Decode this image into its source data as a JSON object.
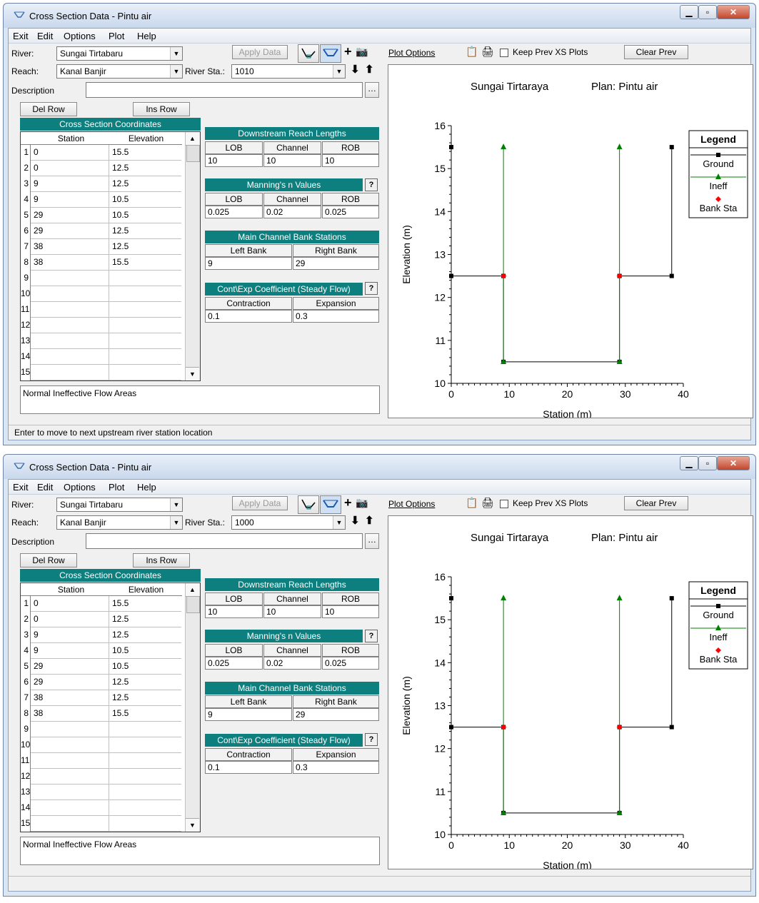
{
  "windows": [
    {
      "title": "Cross Section Data - Pintu air",
      "menu": [
        "Exit",
        "Edit",
        "Options",
        "Plot",
        "Help"
      ],
      "river_label": "River:",
      "river_value": "Sungai Tirtabaru",
      "reach_label": "Reach:",
      "reach_value": "Kanal Banjir",
      "river_sta_label": "River Sta.:",
      "river_sta_value": "1010",
      "apply_data": "Apply Data",
      "description_label": "Description",
      "del_row": "Del Row",
      "ins_row": "Ins Row",
      "xs_coords_title": "Cross Section Coordinates",
      "col_station": "Station",
      "col_elevation": "Elevation",
      "rows": [
        {
          "n": "1",
          "station": "0",
          "elevation": "15.5"
        },
        {
          "n": "2",
          "station": "0",
          "elevation": "12.5"
        },
        {
          "n": "3",
          "station": "9",
          "elevation": "12.5"
        },
        {
          "n": "4",
          "station": "9",
          "elevation": "10.5"
        },
        {
          "n": "5",
          "station": "29",
          "elevation": "10.5"
        },
        {
          "n": "6",
          "station": "29",
          "elevation": "12.5"
        },
        {
          "n": "7",
          "station": "38",
          "elevation": "12.5"
        },
        {
          "n": "8",
          "station": "38",
          "elevation": "15.5"
        },
        {
          "n": "9",
          "station": "",
          "elevation": ""
        },
        {
          "n": "10",
          "station": "",
          "elevation": ""
        },
        {
          "n": "11",
          "station": "",
          "elevation": ""
        },
        {
          "n": "12",
          "station": "",
          "elevation": ""
        },
        {
          "n": "13",
          "station": "",
          "elevation": ""
        },
        {
          "n": "14",
          "station": "",
          "elevation": ""
        },
        {
          "n": "15",
          "station": "",
          "elevation": ""
        }
      ],
      "downstream_title": "Downstream Reach Lengths",
      "lob": "LOB",
      "channel": "Channel",
      "rob": "ROB",
      "reach_lob": "10",
      "reach_channel": "10",
      "reach_rob": "10",
      "manning_title": "Manning's n Values",
      "n_lob": "0.025",
      "n_channel": "0.02",
      "n_rob": "0.025",
      "bank_title": "Main Channel Bank Stations",
      "left_bank_label": "Left Bank",
      "right_bank_label": "Right Bank",
      "left_bank": "9",
      "right_bank": "29",
      "coef_title": "Cont\\Exp Coefficient (Steady Flow)",
      "contraction_label": "Contraction",
      "expansion_label": "Expansion",
      "contraction": "0.1",
      "expansion": "0.3",
      "ineff_text": "Normal Ineffective Flow Areas",
      "status": "Enter to move to next upstream river station location",
      "plot_options": "Plot Options",
      "keep_prev": "Keep Prev XS Plots",
      "clear_prev": "Clear Prev",
      "plot_title_left": "Sungai Tirtaraya",
      "plot_title_right": "Plan: Pintu air"
    },
    {
      "title": "Cross Section Data - Pintu air",
      "menu": [
        "Exit",
        "Edit",
        "Options",
        "Plot",
        "Help"
      ],
      "river_label": "River:",
      "river_value": "Sungai Tirtabaru",
      "reach_label": "Reach:",
      "reach_value": "Kanal Banjir",
      "river_sta_label": "River Sta.:",
      "river_sta_value": "1000",
      "apply_data": "Apply Data",
      "description_label": "Description",
      "del_row": "Del Row",
      "ins_row": "Ins Row",
      "xs_coords_title": "Cross Section Coordinates",
      "col_station": "Station",
      "col_elevation": "Elevation",
      "rows": [
        {
          "n": "1",
          "station": "0",
          "elevation": "15.5"
        },
        {
          "n": "2",
          "station": "0",
          "elevation": "12.5"
        },
        {
          "n": "3",
          "station": "9",
          "elevation": "12.5"
        },
        {
          "n": "4",
          "station": "9",
          "elevation": "10.5"
        },
        {
          "n": "5",
          "station": "29",
          "elevation": "10.5"
        },
        {
          "n": "6",
          "station": "29",
          "elevation": "12.5"
        },
        {
          "n": "7",
          "station": "38",
          "elevation": "12.5"
        },
        {
          "n": "8",
          "station": "38",
          "elevation": "15.5"
        },
        {
          "n": "9",
          "station": "",
          "elevation": ""
        },
        {
          "n": "10",
          "station": "",
          "elevation": ""
        },
        {
          "n": "11",
          "station": "",
          "elevation": ""
        },
        {
          "n": "12",
          "station": "",
          "elevation": ""
        },
        {
          "n": "13",
          "station": "",
          "elevation": ""
        },
        {
          "n": "14",
          "station": "",
          "elevation": ""
        },
        {
          "n": "15",
          "station": "",
          "elevation": ""
        }
      ],
      "downstream_title": "Downstream Reach Lengths",
      "lob": "LOB",
      "channel": "Channel",
      "rob": "ROB",
      "reach_lob": "10",
      "reach_channel": "10",
      "reach_rob": "10",
      "manning_title": "Manning's n Values",
      "n_lob": "0.025",
      "n_channel": "0.02",
      "n_rob": "0.025",
      "bank_title": "Main Channel Bank Stations",
      "left_bank_label": "Left Bank",
      "right_bank_label": "Right Bank",
      "left_bank": "9",
      "right_bank": "29",
      "coef_title": "Cont\\Exp Coefficient (Steady Flow)",
      "contraction_label": "Contraction",
      "expansion_label": "Expansion",
      "contraction": "0.1",
      "expansion": "0.3",
      "ineff_text": "Normal Ineffective Flow Areas",
      "status": "",
      "plot_options": "Plot Options",
      "keep_prev": "Keep Prev XS Plots",
      "clear_prev": "Clear Prev",
      "plot_title_left": "Sungai Tirtaraya",
      "plot_title_right": "Plan: Pintu air"
    }
  ],
  "chart_data": [
    {
      "type": "line",
      "xlabel": "Station (m)",
      "ylabel": "Elevation (m)",
      "xlim": [
        0,
        40
      ],
      "ylim": [
        10,
        16
      ],
      "xticks": [
        "0",
        "10",
        "20",
        "30",
        "40"
      ],
      "yticks": [
        "10",
        "11",
        "12",
        "13",
        "14",
        "15",
        "16"
      ],
      "legend_title": "Legend",
      "legend_position": "right",
      "series": [
        {
          "name": "Ground",
          "color": "#000000",
          "marker": "square",
          "x": [
            0,
            0,
            9,
            9,
            29,
            29,
            38,
            38
          ],
          "y": [
            15.5,
            12.5,
            12.5,
            10.5,
            10.5,
            12.5,
            12.5,
            15.5
          ]
        },
        {
          "name": "Ineff",
          "color": "#008000",
          "marker": "triangle",
          "x": [
            9,
            9,
            29,
            29
          ],
          "y": [
            15.5,
            10.5,
            10.5,
            15.5
          ],
          "segments": [
            [
              0,
              1
            ],
            [
              2,
              3
            ]
          ]
        },
        {
          "name": "Bank Sta",
          "color": "#ff0000",
          "marker": "diamond",
          "x": [
            9,
            29
          ],
          "y": [
            12.5,
            12.5
          ]
        }
      ]
    },
    {
      "type": "line",
      "xlabel": "Station (m)",
      "ylabel": "Elevation (m)",
      "xlim": [
        0,
        40
      ],
      "ylim": [
        10,
        16
      ],
      "xticks": [
        "0",
        "10",
        "20",
        "30",
        "40"
      ],
      "yticks": [
        "10",
        "11",
        "12",
        "13",
        "14",
        "15",
        "16"
      ],
      "legend_title": "Legend",
      "legend_position": "right",
      "series": [
        {
          "name": "Ground",
          "color": "#000000",
          "marker": "square",
          "x": [
            0,
            0,
            9,
            9,
            29,
            29,
            38,
            38
          ],
          "y": [
            15.5,
            12.5,
            12.5,
            10.5,
            10.5,
            12.5,
            12.5,
            15.5
          ]
        },
        {
          "name": "Ineff",
          "color": "#008000",
          "marker": "triangle",
          "x": [
            9,
            9,
            29,
            29
          ],
          "y": [
            15.5,
            10.5,
            10.5,
            15.5
          ],
          "segments": [
            [
              0,
              1
            ],
            [
              2,
              3
            ]
          ]
        },
        {
          "name": "Bank Sta",
          "color": "#ff0000",
          "marker": "diamond",
          "x": [
            9,
            29
          ],
          "y": [
            12.5,
            12.5
          ]
        }
      ]
    }
  ]
}
